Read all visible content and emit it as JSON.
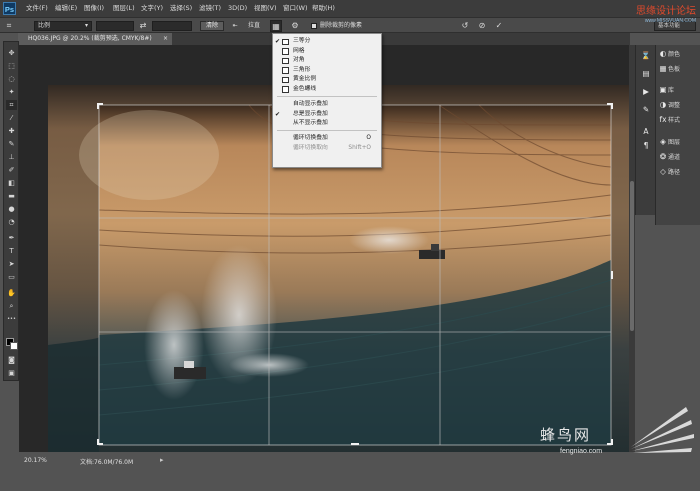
{
  "app": {
    "logo": "Ps"
  },
  "menu": [
    "文件(F)",
    "编辑(E)",
    "图像(I)",
    "图层(L)",
    "文字(Y)",
    "选择(S)",
    "滤镜(T)",
    "3D(D)",
    "视图(V)",
    "窗口(W)",
    "帮助(H)"
  ],
  "watermarks": {
    "top": "思缘设计论坛",
    "top_url": "www.MISSVUAN.COM",
    "bottom": "蜂鸟网",
    "bottom_url": "fengniao.com"
  },
  "options": {
    "ratio_select": "比例",
    "clear_button": "清除",
    "straighten_label": "拉直",
    "delete_pixels_label": "删除裁剪的像素",
    "delete_pixels_checked": true,
    "workspace": "基本功能"
  },
  "document_tab": "HQ036.JPG @ 20.2% (裁剪预选, CMYK/8#)",
  "overlay_menu": {
    "items": [
      {
        "label": "三等分",
        "checked": true
      },
      {
        "label": "网格",
        "checked": false
      },
      {
        "label": "对角",
        "checked": false
      },
      {
        "label": "三角形",
        "checked": false
      },
      {
        "label": "黄金比例",
        "checked": false
      },
      {
        "label": "金色螺线",
        "checked": false
      }
    ],
    "display_items": [
      {
        "label": "自动显示叠加",
        "checked": false
      },
      {
        "label": "总是显示叠加",
        "checked": true
      },
      {
        "label": "从不显示叠加",
        "checked": false
      }
    ],
    "cycle_items": [
      {
        "label": "循环切换叠加",
        "shortcut": "O",
        "disabled": false
      },
      {
        "label": "循环切换取向",
        "shortcut": "Shift+O",
        "disabled": true
      }
    ]
  },
  "panels": [
    "颜色",
    "色板",
    "库",
    "调整",
    "样式",
    "图层",
    "通道",
    "路径"
  ],
  "status": {
    "zoom": "20.17%",
    "doc": "文档:76.0M/76.0M"
  },
  "colors": {
    "accent": "#0f3a63",
    "menu_bg": "#f0f0f0",
    "watermark_red": "#e24a2c"
  }
}
